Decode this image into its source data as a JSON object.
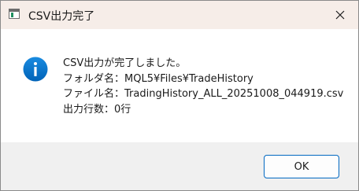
{
  "window": {
    "title": "CSV出力完了",
    "icon": "app-window-icon",
    "close_icon": "close-icon"
  },
  "dialog": {
    "icon": "info-icon",
    "accent_color": "#0078d4",
    "lines": [
      "CSV出力が完了しました。",
      "フォルダ名：MQL5¥Files¥TradeHistory",
      "ファイル名：TradingHistory_ALL_20251008_044919.csv",
      "出力行数：0行"
    ]
  },
  "buttons": {
    "ok_label": "OK"
  }
}
